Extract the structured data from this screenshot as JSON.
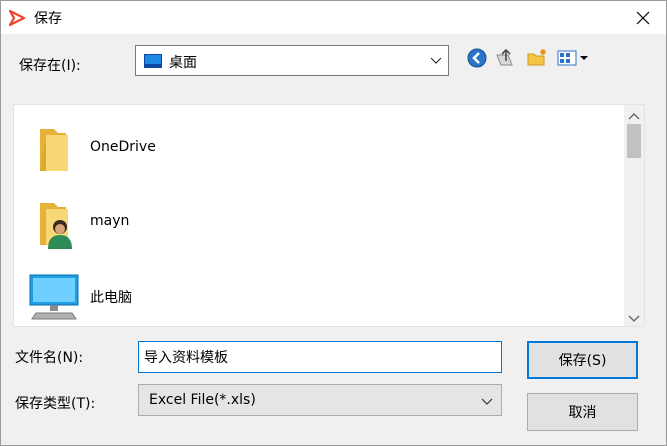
{
  "window": {
    "title": "保存",
    "accent_color": "#0078d7"
  },
  "location": {
    "label": "保存在(I):",
    "value": "桌面",
    "icon": "desktop-icon"
  },
  "toolbar": {
    "icons": [
      "back-icon",
      "up-folder-icon",
      "new-folder-icon",
      "view-menu-icon"
    ]
  },
  "file_list": {
    "items": [
      {
        "label": "OneDrive",
        "icon": "folder-icon"
      },
      {
        "label": "mayn",
        "icon": "user-folder-icon"
      },
      {
        "label": "此电脑",
        "icon": "computer-icon"
      }
    ]
  },
  "filename": {
    "label": "文件名(N):",
    "value": "导入资料模板"
  },
  "filetype": {
    "label": "保存类型(T):",
    "value": "Excel File(*.xls)"
  },
  "buttons": {
    "save": "保存(S)",
    "cancel": "取消"
  }
}
